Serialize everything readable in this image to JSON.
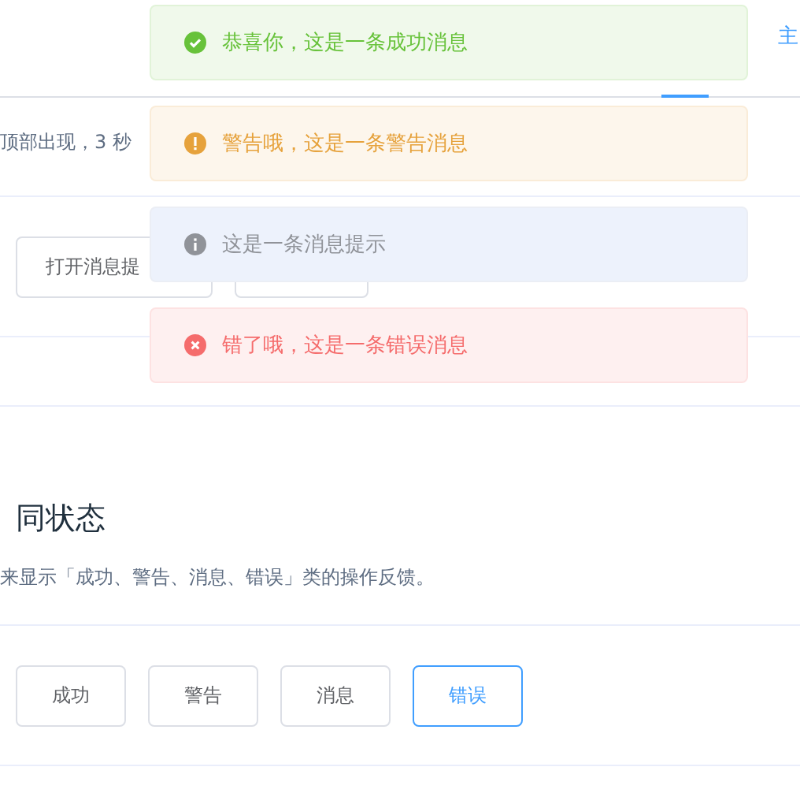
{
  "top_link": {
    "label": "主"
  },
  "section_1": {
    "description": "顶部出现，3 秒",
    "buttons": [
      {
        "kind": "labeled",
        "label": "打开消息提"
      },
      {
        "kind": "covered"
      }
    ]
  },
  "section_2": {
    "title": "同状态",
    "description": "来显示「成功、警告、消息、错误」类的操作反馈。",
    "buttons": [
      {
        "label": "成功",
        "selected": false
      },
      {
        "label": "警告",
        "selected": false
      },
      {
        "label": "消息",
        "selected": false
      },
      {
        "label": "错误",
        "selected": true
      }
    ]
  },
  "messages": [
    {
      "kind": "success",
      "text": "恭喜你，这是一条成功消息"
    },
    {
      "kind": "warning",
      "text": "警告哦，这是一条警告消息"
    },
    {
      "kind": "info",
      "text": "这是一条消息提示"
    },
    {
      "kind": "error",
      "text": "错了哦，这是一条错误消息"
    }
  ]
}
